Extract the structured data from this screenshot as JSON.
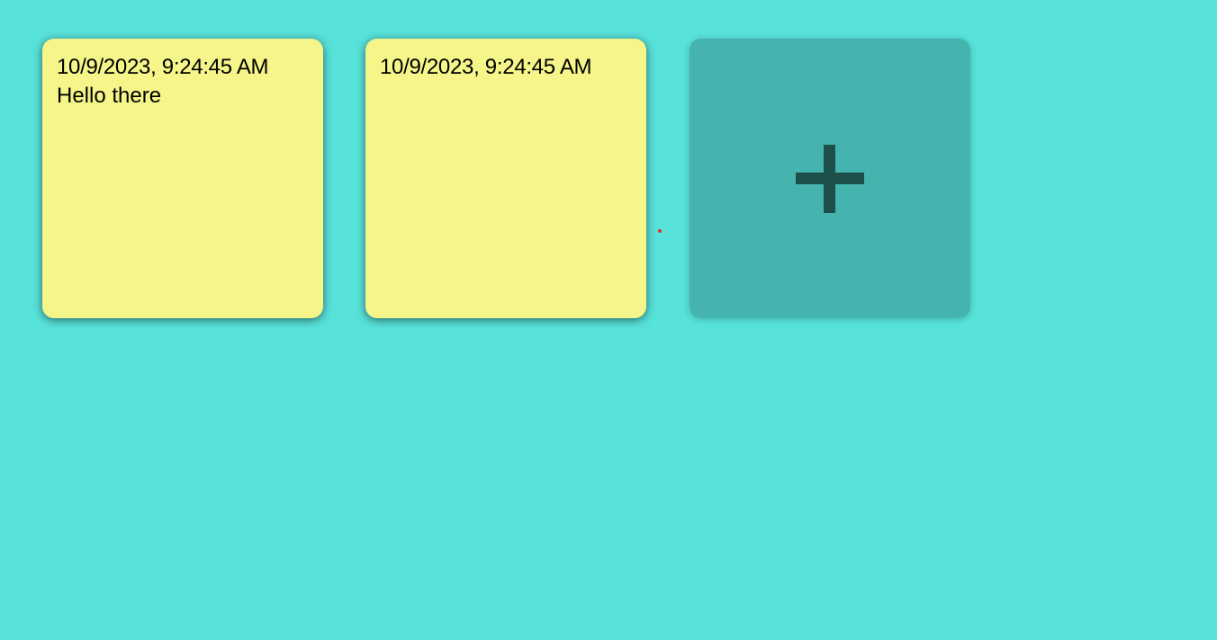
{
  "notes": [
    {
      "timestamp": "10/9/2023, 9:24:45 AM",
      "text": "Hello there"
    },
    {
      "timestamp": "10/9/2023, 9:24:45 AM",
      "text": ""
    }
  ],
  "add_button": {
    "icon": "plus-icon"
  },
  "colors": {
    "background": "#57e2da",
    "note": "#f5f589",
    "add_button": "#45b3ae",
    "plus": "#1d4f4b",
    "cursor_dot": "#e0342b"
  }
}
